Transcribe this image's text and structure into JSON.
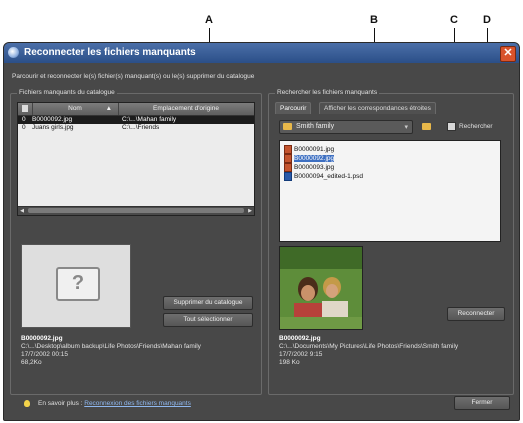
{
  "callouts": [
    "A",
    "B",
    "C",
    "D"
  ],
  "window": {
    "title": "Reconnecter les fichiers manquants",
    "close_glyph": "✕",
    "description": "Parcourir et reconnecter le(s) fichier(s) manquant(s) ou le(s) supprimer du catalogue"
  },
  "left": {
    "group_label": "Fichiers manquants du catalogue",
    "columns": [
      "Nom",
      "Emplacement d'origine"
    ],
    "rows": [
      {
        "num": "0",
        "name": "B0000092.jpg",
        "location": "C:\\...\\Mahan family",
        "selected": true
      },
      {
        "num": "0",
        "name": "Juans girls.jpg",
        "location": "C:\\...\\Friends",
        "selected": false
      }
    ],
    "placeholder_glyph": "?",
    "buttons": {
      "remove": "Supprimer du catalogue",
      "select_all": "Tout sélectionner"
    },
    "info": {
      "filename": "B0000092.jpg",
      "path": "C:\\...\\Desktop\\album backup\\Life Photos\\Friends\\Mahan family",
      "date": "17/7/2002 00:15",
      "size": "68,2Ko"
    }
  },
  "right": {
    "group_label": "Rechercher les fichiers manquants",
    "tabs": [
      "Parcourir",
      "Afficher les correspondances étroites"
    ],
    "folder": "Smith family",
    "search_label": "Rechercher",
    "files": [
      {
        "name": "B0000091.jpg",
        "selected": false
      },
      {
        "name": "B0000092.jpg",
        "selected": true
      },
      {
        "name": "B0000093.jpg",
        "selected": false
      },
      {
        "name": "B0000094_edited-1.psd",
        "selected": false
      }
    ],
    "reconnect_button": "Reconnecter",
    "info": {
      "filename": "B0000092.jpg",
      "path": "C:\\...\\Documents\\My Pictures\\Life Photos\\Friends\\Smith family",
      "date": "17/7/2002 9:15",
      "size": "198 Ko"
    }
  },
  "footer": {
    "learn_more_prefix": "En savoir plus :",
    "learn_more_link": "Reconnexion des fichiers manquants",
    "close_button": "Fermer"
  }
}
